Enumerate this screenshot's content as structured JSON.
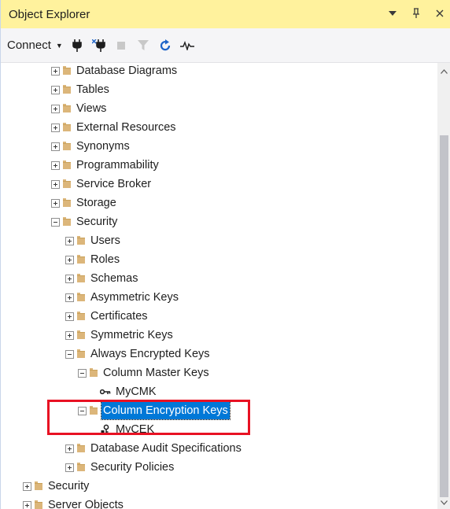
{
  "panel": {
    "title": "Object Explorer",
    "pin_glyph": "▾",
    "autohide_glyph": "ᵖ",
    "close_glyph": "✕"
  },
  "toolbar": {
    "connect_label": "Connect",
    "connect_caret": "▾",
    "icons": [
      "connect-plug-icon",
      "disconnect-plug-icon",
      "stop-icon",
      "filter-icon",
      "refresh-icon",
      "activity-monitor-icon"
    ]
  },
  "tree": {
    "items": [
      {
        "label": "Database Diagrams",
        "expander": "plus"
      },
      {
        "label": "Tables",
        "expander": "plus"
      },
      {
        "label": "Views",
        "expander": "plus"
      },
      {
        "label": "External Resources",
        "expander": "plus"
      },
      {
        "label": "Synonyms",
        "expander": "plus"
      },
      {
        "label": "Programmability",
        "expander": "plus"
      },
      {
        "label": "Service Broker",
        "expander": "plus"
      },
      {
        "label": "Storage",
        "expander": "plus"
      },
      {
        "label": "Security",
        "expander": "minus"
      },
      {
        "label": "Users",
        "expander": "plus"
      },
      {
        "label": "Roles",
        "expander": "plus"
      },
      {
        "label": "Schemas",
        "expander": "plus"
      },
      {
        "label": "Asymmetric Keys",
        "expander": "plus"
      },
      {
        "label": "Certificates",
        "expander": "plus"
      },
      {
        "label": "Symmetric Keys",
        "expander": "plus"
      },
      {
        "label": "Always Encrypted Keys",
        "expander": "minus"
      },
      {
        "label": "Column Master Keys",
        "expander": "minus"
      },
      {
        "label": "MyCMK",
        "icon": "key-icon"
      },
      {
        "label": "Column Encryption Keys",
        "expander": "minus",
        "selected": true
      },
      {
        "label": "MyCEK",
        "icon": "encryption-key-icon"
      },
      {
        "label": "Database Audit Specifications",
        "expander": "plus"
      },
      {
        "label": "Security Policies",
        "expander": "plus"
      },
      {
        "label": "Security",
        "expander": "plus"
      },
      {
        "label": "Server Objects",
        "expander": "plus"
      }
    ]
  },
  "colors": {
    "titlebar_bg": "#fff29d",
    "selection_bg": "#0078d7",
    "highlight_border": "#e81123",
    "folder": "#dcb67a"
  }
}
